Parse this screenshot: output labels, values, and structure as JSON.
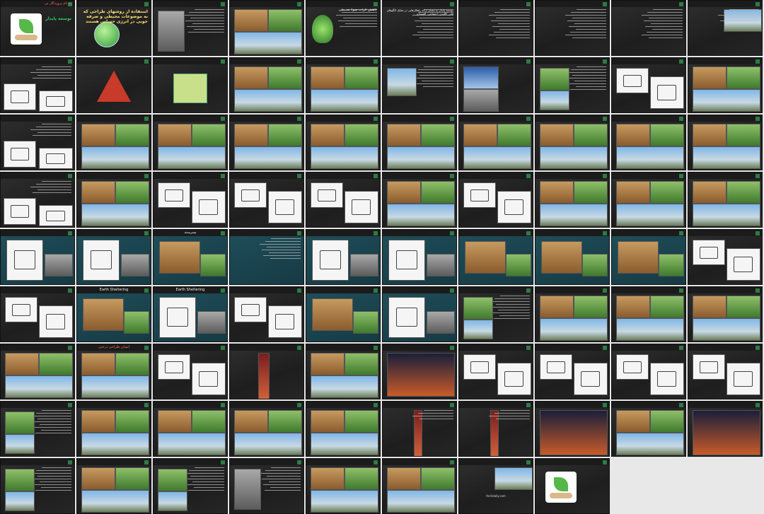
{
  "slides": [
    {
      "title": "به نام پروردگار بی",
      "body": "توسعه پایدار",
      "style": "cover"
    },
    {
      "title": "",
      "body": "استفاده از روشهای طراحی که به موضوعات محیطی و صرفه جویی در انرژی حساس هستند",
      "style": "globe"
    },
    {
      "title": "",
      "body": "",
      "style": "text-photo"
    },
    {
      "title": "",
      "body": "",
      "style": "photos"
    },
    {
      "title": "",
      "body": "کاهش اثرات سوء محیطی",
      "style": "tree"
    },
    {
      "title": "",
      "body": "توسعه پایدار به معنای ارائه راهکارهایی در مقابل الگوهای فانی کالبدی، اجتماعی، اقتصادی",
      "style": "text"
    },
    {
      "title": "",
      "body": "",
      "style": "text"
    },
    {
      "title": "",
      "body": "",
      "style": "text"
    },
    {
      "title": "",
      "body": "",
      "style": "text"
    },
    {
      "title": "",
      "body": "",
      "style": "photo-top"
    },
    {
      "title": "",
      "body": "",
      "style": "text-diagram"
    },
    {
      "title": "",
      "body": "",
      "style": "triangle"
    },
    {
      "title": "",
      "body": "",
      "style": "house"
    },
    {
      "title": "",
      "body": "",
      "style": "photos"
    },
    {
      "title": "",
      "body": "",
      "style": "photos"
    },
    {
      "title": "",
      "body": "",
      "style": "windmill"
    },
    {
      "title": "",
      "body": "",
      "style": "solar"
    },
    {
      "title": "",
      "body": "",
      "style": "photo-text"
    },
    {
      "title": "",
      "body": "",
      "style": "diagram"
    },
    {
      "title": "",
      "body": "",
      "style": "photos"
    },
    {
      "title": "",
      "body": "",
      "style": "text-diagram"
    },
    {
      "title": "",
      "body": "",
      "style": "photos"
    },
    {
      "title": "",
      "body": "",
      "style": "photos"
    },
    {
      "title": "",
      "body": "",
      "style": "photos"
    },
    {
      "title": "",
      "body": "",
      "style": "photos"
    },
    {
      "title": "",
      "body": "",
      "style": "photos"
    },
    {
      "title": "",
      "body": "",
      "style": "photos"
    },
    {
      "title": "",
      "body": "",
      "style": "photos"
    },
    {
      "title": "",
      "body": "",
      "style": "photos"
    },
    {
      "title": "",
      "body": "",
      "style": "photos"
    },
    {
      "title": "",
      "body": "",
      "style": "text-diagram"
    },
    {
      "title": "",
      "body": "",
      "style": "photos"
    },
    {
      "title": "",
      "body": "",
      "style": "diagram"
    },
    {
      "title": "",
      "body": "",
      "style": "diagram"
    },
    {
      "title": "",
      "body": "",
      "style": "diagram"
    },
    {
      "title": "",
      "body": "",
      "style": "photos"
    },
    {
      "title": "",
      "body": "",
      "style": "diagram"
    },
    {
      "title": "",
      "body": "",
      "style": "photos"
    },
    {
      "title": "",
      "body": "",
      "style": "photos"
    },
    {
      "title": "",
      "body": "",
      "style": "photos"
    },
    {
      "title": "",
      "body": "",
      "style": "teal-diagram"
    },
    {
      "title": "",
      "body": "",
      "style": "teal-diagram"
    },
    {
      "title": "پسرسته",
      "body": "",
      "style": "teal-photo"
    },
    {
      "title": "",
      "body": "",
      "style": "mindmap"
    },
    {
      "title": "",
      "body": "",
      "style": "teal-diagram"
    },
    {
      "title": "",
      "body": "",
      "style": "teal-diagram"
    },
    {
      "title": "",
      "body": "",
      "style": "teal-photo"
    },
    {
      "title": "",
      "body": "",
      "style": "teal-photo"
    },
    {
      "title": "",
      "body": "",
      "style": "teal-photo"
    },
    {
      "title": "",
      "body": "",
      "style": "diagram"
    },
    {
      "title": "",
      "body": "",
      "style": "diagram"
    },
    {
      "title": "Earth Sheltering",
      "body": "",
      "style": "teal-photo"
    },
    {
      "title": "Earth Sheltering",
      "body": "",
      "style": "teal-diagram"
    },
    {
      "title": "",
      "body": "",
      "style": "diagram"
    },
    {
      "title": "",
      "body": "",
      "style": "teal-photo"
    },
    {
      "title": "",
      "body": "",
      "style": "teal-diagram"
    },
    {
      "title": "",
      "body": "",
      "style": "photo-text"
    },
    {
      "title": "",
      "body": "",
      "style": "photos"
    },
    {
      "title": "",
      "body": "",
      "style": "photos"
    },
    {
      "title": "",
      "body": "",
      "style": "photos"
    },
    {
      "title": "",
      "body": "",
      "style": "photos"
    },
    {
      "title": "انسان طراحی درختی",
      "body": "",
      "style": "photos"
    },
    {
      "title": "",
      "body": "",
      "style": "diagram"
    },
    {
      "title": "",
      "body": "",
      "style": "tower"
    },
    {
      "title": "",
      "body": "",
      "style": "photos"
    },
    {
      "title": "",
      "body": "",
      "style": "sky"
    },
    {
      "title": "",
      "body": "",
      "style": "diagram"
    },
    {
      "title": "",
      "body": "",
      "style": "diagram"
    },
    {
      "title": "",
      "body": "",
      "style": "diagram"
    },
    {
      "title": "",
      "body": "",
      "style": "diagram"
    },
    {
      "title": "",
      "body": "",
      "style": "photo-text"
    },
    {
      "title": "",
      "body": "",
      "style": "photos"
    },
    {
      "title": "",
      "body": "",
      "style": "photos"
    },
    {
      "title": "",
      "body": "",
      "style": "photos"
    },
    {
      "title": "",
      "body": "",
      "style": "photos"
    },
    {
      "title": "",
      "body": "",
      "style": "red-tower"
    },
    {
      "title": "",
      "body": "",
      "style": "red-tower"
    },
    {
      "title": "",
      "body": "",
      "style": "night"
    },
    {
      "title": "",
      "body": "",
      "style": "photos"
    },
    {
      "title": "",
      "body": "",
      "style": "night"
    },
    {
      "title": "",
      "body": "",
      "style": "photo-text"
    },
    {
      "title": "",
      "body": "",
      "style": "photos"
    },
    {
      "title": "",
      "body": "",
      "style": "photo-text"
    },
    {
      "title": "",
      "body": "",
      "style": "text-photo"
    },
    {
      "title": "",
      "body": "",
      "style": "photos"
    },
    {
      "title": "",
      "body": "",
      "style": "photos"
    },
    {
      "title": "",
      "body": "Archdaily.com",
      "style": "refs"
    },
    {
      "title": "",
      "body": "",
      "style": "end"
    },
    {
      "title": "",
      "body": "",
      "style": "blank"
    },
    {
      "title": "",
      "body": "",
      "style": "blank"
    }
  ],
  "colors": {
    "accent_red": "#ff6a5a",
    "slide_bg": "#262626",
    "teal": "#1f4f5a",
    "green_mark": "#2d7a45"
  }
}
